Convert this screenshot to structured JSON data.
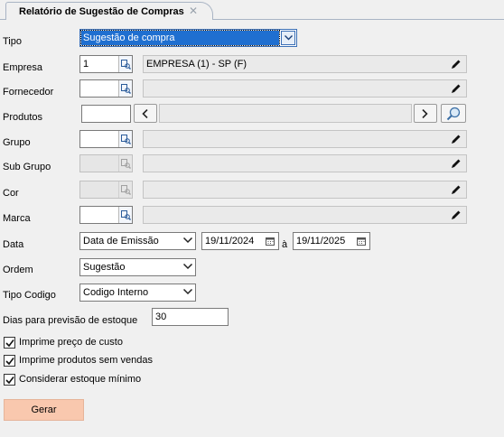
{
  "tab": {
    "title": "Relatório de Sugestão de Compras",
    "close_symbol": "✕"
  },
  "labels": {
    "tipo": "Tipo",
    "empresa": "Empresa",
    "fornecedor": "Fornecedor",
    "produtos": "Produtos",
    "grupo": "Grupo",
    "subgrupo": "Sub Grupo",
    "cor": "Cor",
    "marca": "Marca",
    "data": "Data",
    "ordem": "Ordem",
    "tipo_codigo": "Tipo Codigo",
    "dias": "Dias para previsão de estoque"
  },
  "fields": {
    "tipo": "Sugestão de compra",
    "empresa_code": "1",
    "empresa_desc": "EMPRESA (1) - SP (F)",
    "fornecedor_code": "",
    "fornecedor_desc": "",
    "produtos_code": "",
    "grupo_code": "",
    "subgrupo_code": "",
    "cor_code": "",
    "marca_code": "",
    "data_tipo": "Data de Emissão",
    "data_inicio": "19/11/2024",
    "data_sep": "à",
    "data_fim": "19/11/2025",
    "ordem": "Sugestão",
    "tipo_codigo": "Codigo Interno",
    "dias": "30"
  },
  "checkboxes": [
    {
      "label": "Imprime preço de custo",
      "checked": true
    },
    {
      "label": "Imprime produtos sem vendas",
      "checked": true
    },
    {
      "label": "Considerar estoque mínimo",
      "checked": true
    }
  ],
  "buttons": {
    "gerar": "Gerar"
  },
  "colors": {
    "selection": "#1f6fd0",
    "gerar_bg": "#f9c8ae",
    "background": "#f0f0f0"
  },
  "icons": [
    "lookup-icon",
    "pencil-icon",
    "chevron-down-icon",
    "calendar-icon",
    "chevron-left-icon",
    "chevron-right-icon",
    "search-icon",
    "checkmark-icon",
    "close-icon"
  ]
}
